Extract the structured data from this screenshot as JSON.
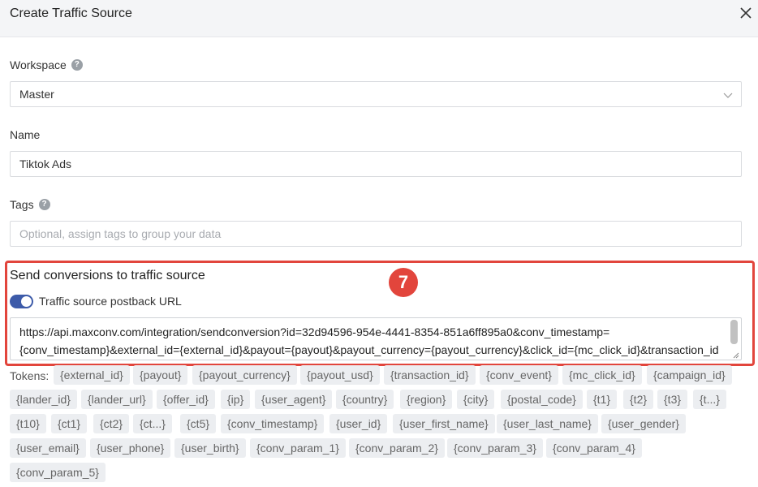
{
  "dialog": {
    "title": "Create Traffic Source"
  },
  "workspace": {
    "label": "Workspace",
    "help": "?",
    "value": "Master"
  },
  "name": {
    "label": "Name",
    "value": "Tiktok Ads"
  },
  "tags": {
    "label": "Tags",
    "help": "?",
    "placeholder": "Optional, assign tags to group your data"
  },
  "postback": {
    "section_title": "Send conversions to traffic source",
    "step_badge": "7",
    "toggle_label": "Traffic source postback URL",
    "toggle_on": true,
    "url_line_1": "https://api.maxconv.com/integration/sendconversion?id=32d94596-954e-4441-8354-851a6ff895a0&conv_timestamp=",
    "url_line_2": "{conv_timestamp}&external_id={external_id}&payout={payout}&payout_currency={payout_currency}&click_id={mc_click_id}&transaction_id="
  },
  "tokens": {
    "label": "Tokens:",
    "items": [
      "{external_id}",
      "{payout}",
      "{payout_currency}",
      "{payout_usd}",
      "{transaction_id}",
      "{conv_event}",
      "{mc_click_id}",
      "{campaign_id}",
      "{lander_id}",
      "{lander_url}",
      "{offer_id}",
      "{ip}",
      "{user_agent}",
      "{country}",
      "{region}",
      "{city}",
      "{postal_code}",
      "{t1}",
      "{t2}",
      "{t3}",
      "{t...}",
      "{t10}",
      "{ct1}",
      "{ct2}",
      "{ct...}",
      "{ct5}",
      "{conv_timestamp}",
      "{user_id}",
      "{user_first_name}",
      "{user_last_name}",
      "{user_gender}",
      "{user_email}",
      "{user_phone}",
      "{user_birth}",
      "{conv_param_1}",
      "{conv_param_2}",
      "{conv_param_3}",
      "{conv_param_4}",
      "{conv_param_5}"
    ]
  },
  "colors": {
    "accent": "#3d5ba9",
    "highlight": "#e2453c"
  }
}
